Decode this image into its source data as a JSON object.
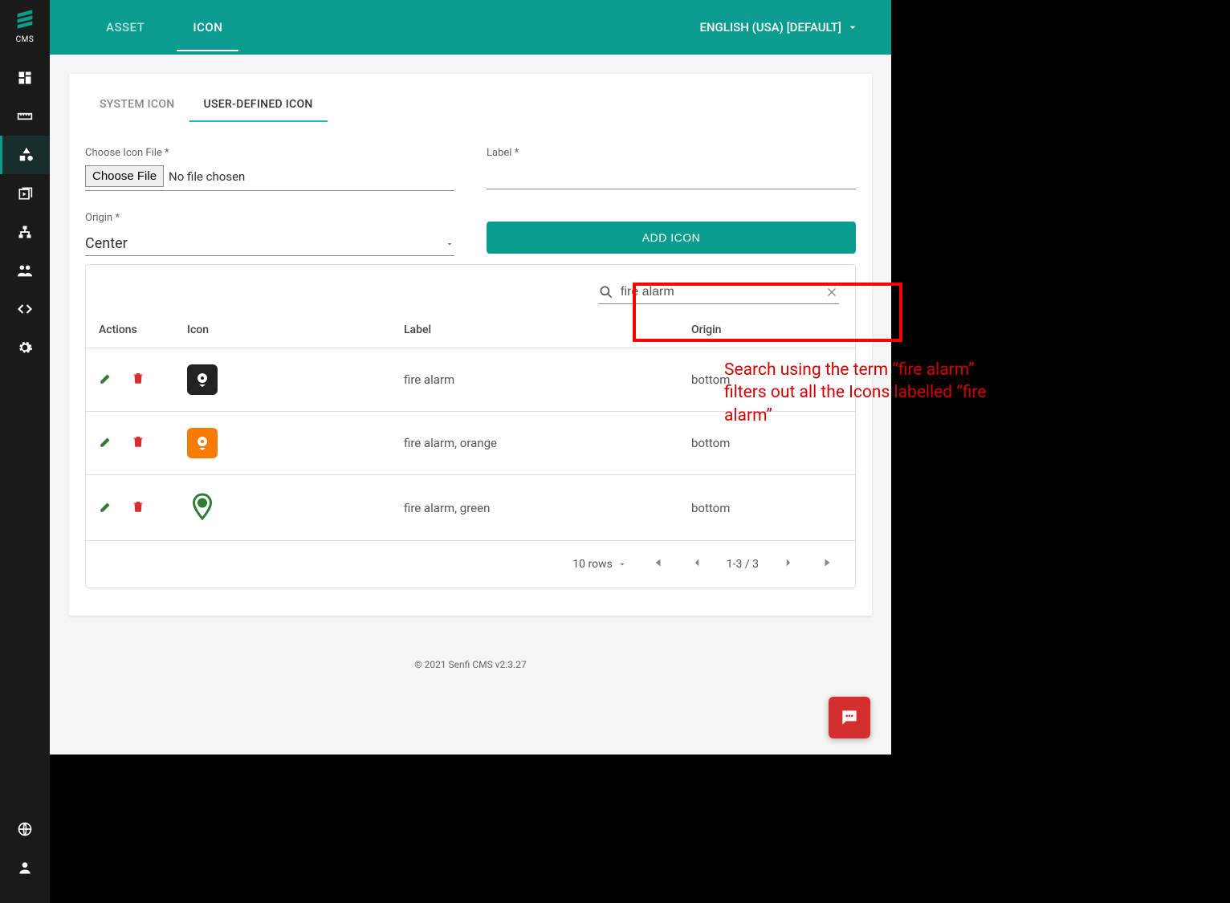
{
  "sidebar": {
    "cms_label": "CMS"
  },
  "topbar": {
    "tabs": [
      {
        "label": "ASSET"
      },
      {
        "label": "ICON"
      }
    ],
    "language": "ENGLISH (USA) [DEFAULT]"
  },
  "subtabs": [
    {
      "label": "SYSTEM ICON"
    },
    {
      "label": "USER-DEFINED ICON"
    }
  ],
  "form": {
    "file_label": "Choose Icon File *",
    "choose_file_btn": "Choose File",
    "no_file_text": "No file chosen",
    "label_label": "Label *",
    "origin_label": "Origin *",
    "origin_value": "Center",
    "add_btn": "ADD ICON"
  },
  "search": {
    "value": "fire alarm"
  },
  "table": {
    "headers": {
      "actions": "Actions",
      "icon": "Icon",
      "label": "Label",
      "origin": "Origin"
    },
    "rows": [
      {
        "label": "fire alarm",
        "origin": "bottom",
        "thumb_bg": "#222",
        "thumb_fg": "#fff"
      },
      {
        "label": "fire alarm, orange",
        "origin": "bottom",
        "thumb_bg": "#f57c00",
        "thumb_fg": "#fff"
      },
      {
        "label": "fire alarm, green",
        "origin": "bottom",
        "thumb_bg": "transparent",
        "thumb_fg": "#2e7d32"
      }
    ]
  },
  "pager": {
    "rows_label": "10 rows",
    "range": "1-3 / 3"
  },
  "footer": "© 2021 Senfi CMS v2.3.27",
  "annotation": "Search using the term “fire alarm” filters out all the Icons labelled “fire alarm”"
}
